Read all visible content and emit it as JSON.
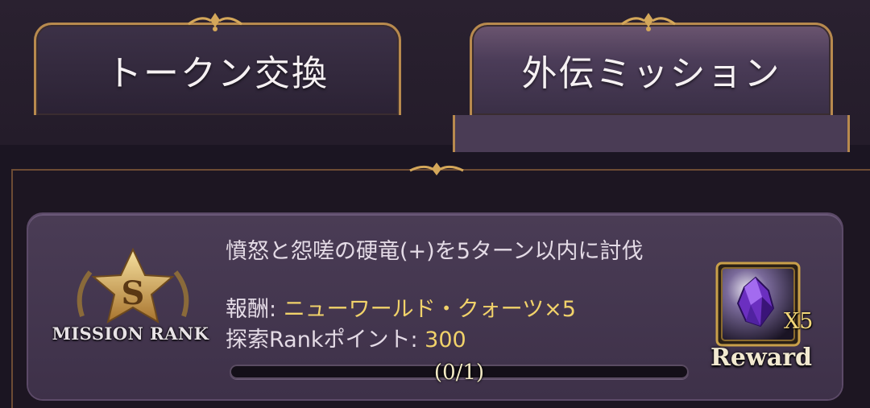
{
  "tabs": [
    {
      "label": "トークン交換",
      "active": false
    },
    {
      "label": "外伝ミッション",
      "active": true
    }
  ],
  "mission": {
    "rank_letter": "S",
    "rank_label": "MISSION RANK",
    "title": "憤怒と怨嗟の硬竜(+)を5ターン以内に討伐",
    "reward_prefix": "報酬: ",
    "reward_value": "ニューワールド・クォーツ×5",
    "points_prefix": "探索Rankポイント: ",
    "points_value": "300",
    "progress_text": "(0/1)",
    "progress_fraction": 0
  },
  "reward": {
    "icon": "purple-crystal-icon",
    "quantity": "X5",
    "label": "Reward"
  },
  "colors": {
    "accent_gold": "#b88a4e",
    "highlight_text": "#f1d26a",
    "card_bg": "#4a3c55"
  }
}
